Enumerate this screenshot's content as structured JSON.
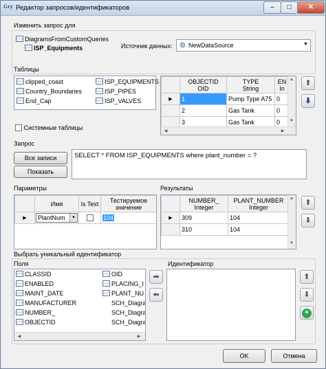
{
  "window": {
    "app_icon": "Gry",
    "title": "Редактор запросов/идентификаторов",
    "min": "–",
    "max": "□",
    "close": "✕"
  },
  "change_query": {
    "group_label": "Изменить запрос для",
    "tree_parent": "DiagramsFromCustomQueries",
    "tree_child": "ISP_Equipments",
    "datasource_label": "Источник данных:",
    "datasource_value": "NewDataSource"
  },
  "tables": {
    "label": "Таблицы",
    "left_col": [
      "clipped_coast",
      "Country_Boundaries",
      "End_Cap"
    ],
    "right_col": [
      "ISP_EQUIPMENTS",
      "ISP_PIPES",
      "ISP_VALVES"
    ],
    "system_checkbox": "Системные таблицы",
    "grid_headers": [
      {
        "name": "OBJECTID",
        "type": "OID"
      },
      {
        "name": "TYPE",
        "type": "String"
      },
      {
        "name": "EN",
        "type": "In"
      }
    ],
    "grid_rows": [
      [
        "1",
        "Pump Type A75",
        "0"
      ],
      [
        "2",
        "Gas Tank",
        "0"
      ],
      [
        "3",
        "Gas Tank",
        "0"
      ]
    ]
  },
  "query": {
    "label": "Запрос",
    "all_records": "Все записи",
    "show": "Показать",
    "text": "SELECT * FROM ISP_EQUIPMENTS where plant_number = ?"
  },
  "params": {
    "label": "Параметры",
    "headers": [
      "Имя",
      "Is Text",
      "Тестируемое значение"
    ],
    "row": {
      "name": "PlantNum",
      "test": "104"
    }
  },
  "results": {
    "label": "Результаты",
    "headers": [
      {
        "name": "NUMBER_",
        "type": "Integer"
      },
      {
        "name": "PLANT_NUMBER",
        "type": "Integer"
      }
    ],
    "rows": [
      [
        "309",
        "104"
      ],
      [
        "310",
        "104"
      ]
    ]
  },
  "identifier": {
    "group_label": "Выбрать уникальный идентификатор",
    "fields_label": "Поля",
    "fields_left": [
      "CLASSID",
      "ENABLED",
      "MAINT_DATE",
      "MANUFACTURER",
      "NUMBER_",
      "OBJECTID"
    ],
    "fields_right": [
      "OID",
      "PLACING_I",
      "PLANT_NU",
      "SCH_Diagra",
      "SCH_Diagra",
      "SCH_Diagra"
    ],
    "id_label": "Идентификатор"
  },
  "footer": {
    "ok": "OK",
    "cancel": "Отмена"
  }
}
